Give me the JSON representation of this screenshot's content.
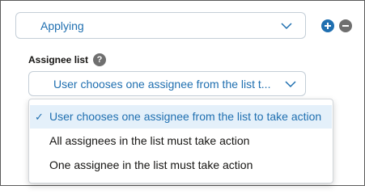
{
  "status_select": {
    "value": "Applying"
  },
  "actions": {
    "add_icon": "plus-circle-icon",
    "remove_icon": "minus-circle-icon",
    "add_color": "#1f6fb0",
    "remove_color": "#6f6f6f"
  },
  "assignee_list": {
    "label": "Assignee list",
    "help_glyph": "?",
    "selected_display": "User chooses one assignee from the list t...",
    "options": [
      "User chooses one assignee from the list to take action",
      "All assignees in the list must take action",
      "One assignee in the list must take action"
    ],
    "selected_index": 0,
    "check_glyph": "✓"
  }
}
